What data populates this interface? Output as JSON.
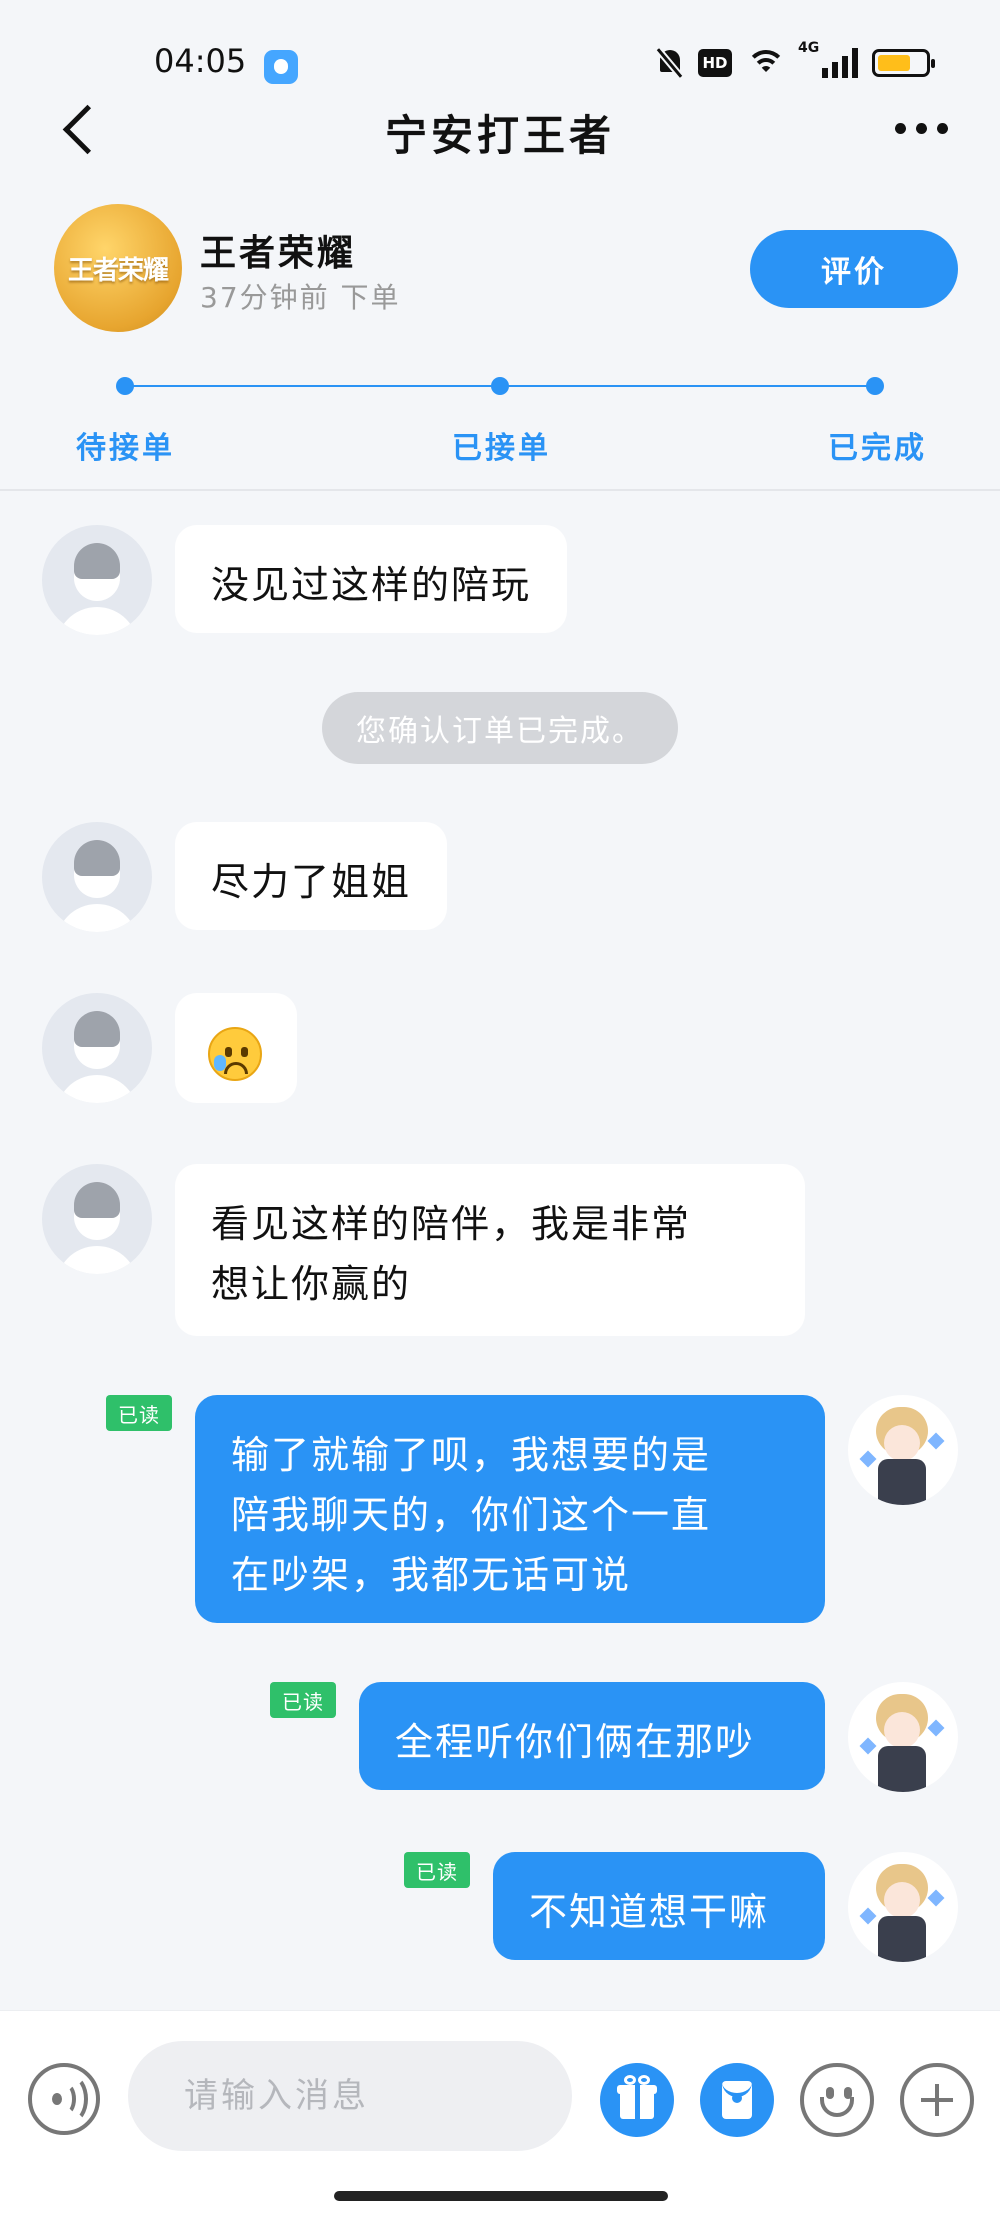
{
  "status_bar": {
    "time": "04:05",
    "hd_label": "HD",
    "network_label": "4G",
    "battery_level": 0.7,
    "icons": [
      "app-icon",
      "bell-off-icon",
      "hd-icon",
      "wifi-icon",
      "signal-icon",
      "battery-icon"
    ]
  },
  "header": {
    "title": "宁安打王者",
    "back_icon": "chevron-left-icon",
    "more_icon": "more-icon"
  },
  "order": {
    "game_logo_text": "王者荣耀",
    "game_name": "王者荣耀",
    "time_text": "37分钟前 下单",
    "rate_button": "评价",
    "steps": [
      "待接单",
      "已接单",
      "已完成"
    ]
  },
  "chat": {
    "system_notice": "您确认订单已完成。",
    "read_label": "已读",
    "messages": [
      {
        "from": "other",
        "text": "没见过这样的陪玩"
      },
      {
        "from": "other",
        "text": "尽力了姐姐"
      },
      {
        "from": "other",
        "emoji": "sad-sweat-emoji"
      },
      {
        "from": "other",
        "lines": [
          "看见这样的陪伴，我是非常",
          "想让你赢的"
        ]
      },
      {
        "from": "me",
        "lines": [
          "输了就输了呗，我想要的是",
          "陪我聊天的，你们这个一直",
          "在吵架，我都无话可说"
        ]
      },
      {
        "from": "me",
        "text": "全程听你们俩在那吵"
      },
      {
        "from": "me",
        "text": "不知道想干嘛"
      }
    ]
  },
  "input": {
    "placeholder": "请输入消息",
    "value": ""
  },
  "colors": {
    "accent": "#2a93f5",
    "read_tag": "#2fc06a",
    "background": "#f4f6f9"
  }
}
